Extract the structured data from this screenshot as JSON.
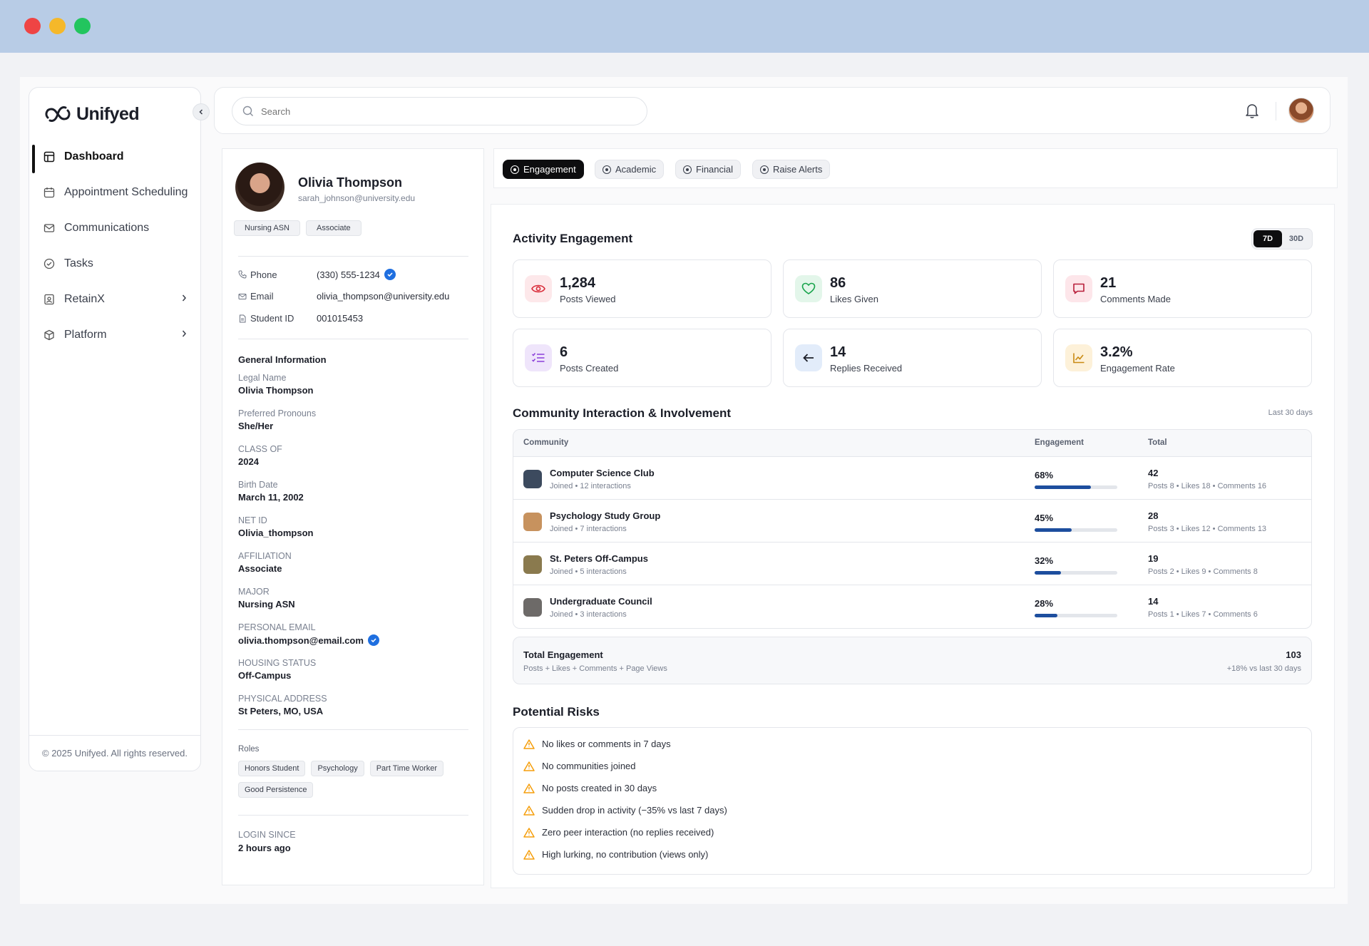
{
  "app": {
    "logo_text": "Unifyed"
  },
  "sidebar": {
    "items": [
      {
        "label": "Dashboard"
      },
      {
        "label": "Appointment Scheduling"
      },
      {
        "label": "Communications"
      },
      {
        "label": "Tasks"
      },
      {
        "label": "RetainX"
      },
      {
        "label": "Platform"
      }
    ],
    "footer": "© 2025 Unifyed. All rights reserved."
  },
  "search": {
    "placeholder": "Search"
  },
  "profile": {
    "name": "Olivia Thompson",
    "email": "sarah_johnson@university.edu",
    "chips": [
      "Nursing ASN",
      "Associate"
    ],
    "contact": {
      "phone_label": "Phone",
      "phone": "(330) 555-1234",
      "email_label": "Email",
      "email": "olivia_thompson@university.edu",
      "student_id_label": "Student ID",
      "student_id": "001015453"
    },
    "general_title": "General Information",
    "general": [
      {
        "label": "Legal Name",
        "value": "Olivia Thompson"
      },
      {
        "label": "Preferred Pronouns",
        "value": "She/Her"
      },
      {
        "label": "CLASS OF",
        "value": "2024"
      },
      {
        "label": "Birth Date",
        "value": "March 11, 2002"
      },
      {
        "label": "NET ID",
        "value": "Olivia_thompson"
      },
      {
        "label": "AFFILIATION",
        "value": "Associate"
      },
      {
        "label": "MAJOR",
        "value": "Nursing ASN"
      },
      {
        "label": "PERSONAL EMAIL",
        "value": "olivia.thompson@email.com"
      },
      {
        "label": "HOUSING STATUS",
        "value": "Off-Campus"
      },
      {
        "label": "PHYSICAL ADDRESS",
        "value": "St Peters, MO, USA"
      }
    ],
    "roles_title": "Roles",
    "roles": [
      "Honors Student",
      "Psychology",
      "Part Time Worker",
      "Good Persistence"
    ],
    "login_label": "LOGIN SINCE",
    "login_value": "2 hours ago"
  },
  "tabs": [
    {
      "label": "Engagement"
    },
    {
      "label": "Academic"
    },
    {
      "label": "Financial"
    },
    {
      "label": "Raise Alerts"
    }
  ],
  "activity": {
    "title": "Activity Engagement",
    "range_options": [
      "7D",
      "30D"
    ],
    "stats": [
      {
        "value": "1,284",
        "label": "Posts Viewed",
        "icon": "eye-icon",
        "color": "#d92d3a",
        "bg": "#fde8ea"
      },
      {
        "value": "86",
        "label": "Likes Given",
        "icon": "heart-icon",
        "color": "#16a34a",
        "bg": "#e3f6ea"
      },
      {
        "value": "21",
        "label": "Comments Made",
        "icon": "comment-icon",
        "color": "#b81e3a",
        "bg": "#fde6ea"
      },
      {
        "value": "6",
        "label": "Posts Created",
        "icon": "list-icon",
        "color": "#8b3fd9",
        "bg": "#efe5fb"
      },
      {
        "value": "14",
        "label": "Replies Received",
        "icon": "arrow-left-icon",
        "color": "#1b1e28",
        "bg": "#e2ecfa"
      },
      {
        "value": "3.2%",
        "label": "Engagement Rate",
        "icon": "chart-icon",
        "color": "#c98a12",
        "bg": "#fdf1d9"
      }
    ]
  },
  "community": {
    "title": "Community Interaction & Involvement",
    "period": "Last 30 days",
    "headers": {
      "community": "Community",
      "engagement": "Engagement",
      "total": "Total"
    },
    "rows": [
      {
        "name": "Computer Science Club",
        "sub": "Joined • 12 interactions",
        "pct_label": "68%",
        "pct": 0.68,
        "total": "42",
        "detail": "Posts 8 • Likes 18 • Comments 16",
        "thumb": "#3c4a5e"
      },
      {
        "name": "Psychology Study Group",
        "sub": "Joined • 7 interactions",
        "pct_label": "45%",
        "pct": 0.45,
        "total": "28",
        "detail": "Posts 3 • Likes 12 • Comments 13",
        "thumb": "#c7925e"
      },
      {
        "name": "St. Peters Off-Campus",
        "sub": "Joined • 5 interactions",
        "pct_label": "32%",
        "pct": 0.32,
        "total": "19",
        "detail": "Posts 2 • Likes 9 • Comments 8",
        "thumb": "#8a7a4e"
      },
      {
        "name": "Undergraduate Council",
        "sub": "Joined • 3 interactions",
        "pct_label": "28%",
        "pct": 0.28,
        "total": "14",
        "detail": "Posts 1 • Likes 7 • Comments 6",
        "thumb": "#6d6a68"
      }
    ],
    "total": {
      "title": "Total Engagement",
      "sub": "Posts + Likes + Comments + Page Views",
      "value": "103",
      "change": "+18% vs last 30 days"
    }
  },
  "risks": {
    "title": "Potential Risks",
    "color": "#f59e0b",
    "items": [
      "No likes or comments in 7 days",
      "No communities joined",
      "No posts created in 30 days",
      "Sudden drop in activity (−35% vs last 7 days)",
      "Zero peer interaction (no replies received)",
      "High lurking, no contribution (views only)"
    ]
  }
}
